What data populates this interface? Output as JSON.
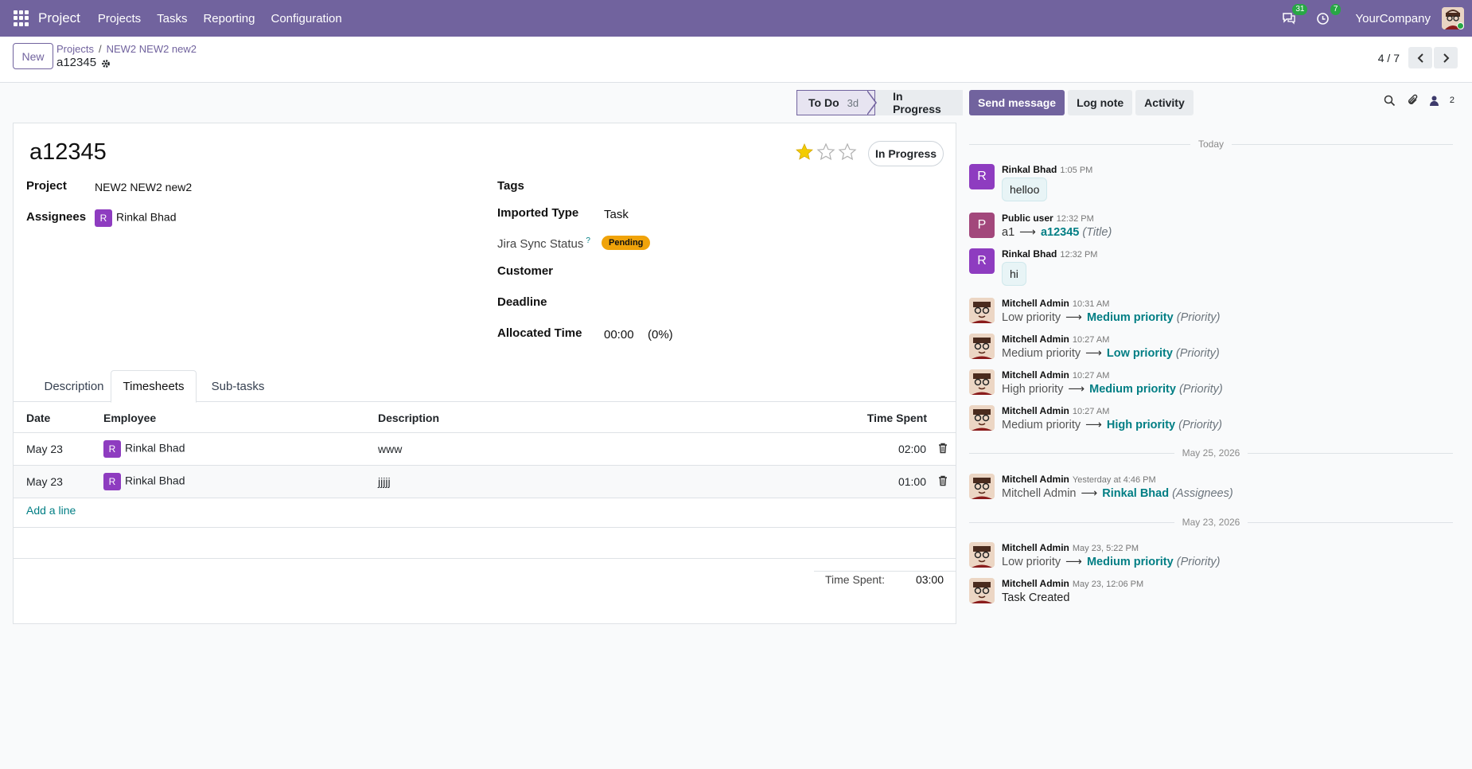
{
  "navbar": {
    "app_name": "Project",
    "menu": [
      "Projects",
      "Tasks",
      "Reporting",
      "Configuration"
    ],
    "messages_count": "31",
    "activities_count": "7",
    "company": "YourCompany"
  },
  "control": {
    "new_label": "New",
    "breadcrumb": [
      "Projects",
      "NEW2 NEW2 new2"
    ],
    "record": "a12345",
    "pager": "4 / 7"
  },
  "status": {
    "stage_active": "To Do",
    "stage_active_days": "3d",
    "stage_next": "In Progress"
  },
  "form": {
    "title": "a12345",
    "priority_stars": 1,
    "state": "In Progress",
    "project_label": "Project",
    "project_value": "NEW2 NEW2 new2",
    "assignees_label": "Assignees",
    "assignee_initial": "R",
    "assignee_name": "Rinkal Bhad",
    "tags_label": "Tags",
    "imported_type_label": "Imported Type",
    "imported_type_value": "Task",
    "jira_label": "Jira Sync Status",
    "jira_help": "?",
    "jira_value": "Pending",
    "customer_label": "Customer",
    "deadline_label": "Deadline",
    "allocated_label": "Allocated Time",
    "allocated_value": "00:00",
    "allocated_pct": "(0%)"
  },
  "tabs": [
    "Description",
    "Timesheets",
    "Sub-tasks"
  ],
  "timesheets": {
    "headers": [
      "Date",
      "Employee",
      "Description",
      "Time Spent"
    ],
    "rows": [
      {
        "date": "May 23",
        "initial": "R",
        "employee": "Rinkal Bhad",
        "description": "www",
        "time": "02:00"
      },
      {
        "date": "May 23",
        "initial": "R",
        "employee": "Rinkal Bhad",
        "description": "jjjjj",
        "time": "01:00"
      }
    ],
    "add_line": "Add a line",
    "total_label": "Time Spent:",
    "total_value": "03:00"
  },
  "chatter": {
    "send_message": "Send message",
    "log_note": "Log note",
    "activity": "Activity",
    "followers_count": "2",
    "sep_today": "Today",
    "sep_may25": "May 25, 2026",
    "sep_may23": "May 23, 2026",
    "messages": [
      {
        "author": "Rinkal Bhad",
        "time": "1:05 PM",
        "initial": "R",
        "body": "helloo"
      },
      {
        "author": "Public user",
        "time": "12:32 PM",
        "initial": "P",
        "old": "a1",
        "new": "a12345",
        "field": "(Title)"
      },
      {
        "author": "Rinkal Bhad",
        "time": "12:32 PM",
        "initial": "R",
        "body": "hi"
      },
      {
        "author": "Mitchell Admin",
        "time": "10:31 AM",
        "old": "Low priority",
        "new": "Medium priority",
        "field": "(Priority)"
      },
      {
        "author": "Mitchell Admin",
        "time": "10:27 AM",
        "old": "Medium priority",
        "new": "Low priority",
        "field": "(Priority)"
      },
      {
        "author": "Mitchell Admin",
        "time": "10:27 AM",
        "old": "High priority",
        "new": "Medium priority",
        "field": "(Priority)"
      },
      {
        "author": "Mitchell Admin",
        "time": "10:27 AM",
        "old": "Medium priority",
        "new": "High priority",
        "field": "(Priority)"
      },
      {
        "author": "Mitchell Admin",
        "time": "Yesterday at 4:46 PM",
        "old": "Mitchell Admin",
        "new": "Rinkal Bhad",
        "field": "(Assignees)"
      },
      {
        "author": "Mitchell Admin",
        "time": "May 23, 5:22 PM",
        "old": "Low priority",
        "new": "Medium priority",
        "field": "(Priority)"
      },
      {
        "author": "Mitchell Admin",
        "time": "May 23, 12:06 PM",
        "body": "Task Created"
      }
    ]
  },
  "colors": {
    "brand": "#71639e",
    "link": "#017e84",
    "star": "#f3cc00",
    "pending": "#f0a30a",
    "avatar_r": "#8e3cc0",
    "avatar_p": "#a2477b"
  }
}
